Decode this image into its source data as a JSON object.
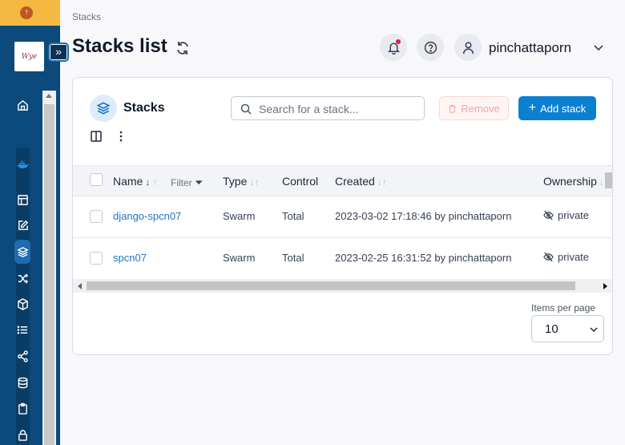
{
  "breadcrumb": "Stacks",
  "page_title": "Stacks list",
  "user": {
    "name": "pinchattaporn"
  },
  "sidebar": {
    "logo_text": "Wye",
    "items": [
      {
        "icon": "home-icon"
      },
      {
        "icon": "docker-icon"
      },
      {
        "icon": "dashboard-icon"
      },
      {
        "icon": "edit-icon"
      },
      {
        "icon": "stacks-icon",
        "active": true
      },
      {
        "icon": "shuffle-icon"
      },
      {
        "icon": "box-icon"
      },
      {
        "icon": "list-icon"
      },
      {
        "icon": "network-icon"
      },
      {
        "icon": "database-icon"
      },
      {
        "icon": "clipboard-icon"
      },
      {
        "icon": "lock-icon"
      }
    ]
  },
  "card": {
    "title": "Stacks",
    "search_placeholder": "Search for a stack...",
    "remove_label": "Remove",
    "add_label": "Add stack"
  },
  "table": {
    "headers": {
      "name": "Name",
      "filter": "Filter",
      "type": "Type",
      "control": "Control",
      "created": "Created",
      "ownership": "Ownership"
    },
    "rows": [
      {
        "name": "django-spcn07",
        "type": "Swarm",
        "control": "Total",
        "created": "2023-03-02 17:18:46 by pinchattaporn",
        "ownership": "private"
      },
      {
        "name": "spcn07",
        "type": "Swarm",
        "control": "Total",
        "created": "2023-02-25 16:31:52 by pinchattaporn",
        "ownership": "private"
      }
    ]
  },
  "pagination": {
    "items_per_page_label": "Items per page",
    "items_per_page_value": "10"
  },
  "colors": {
    "sidebar": "#0b4a7a",
    "accent": "#0b80d0",
    "link": "#1d74c4",
    "warning_bar": "#f5b942"
  }
}
